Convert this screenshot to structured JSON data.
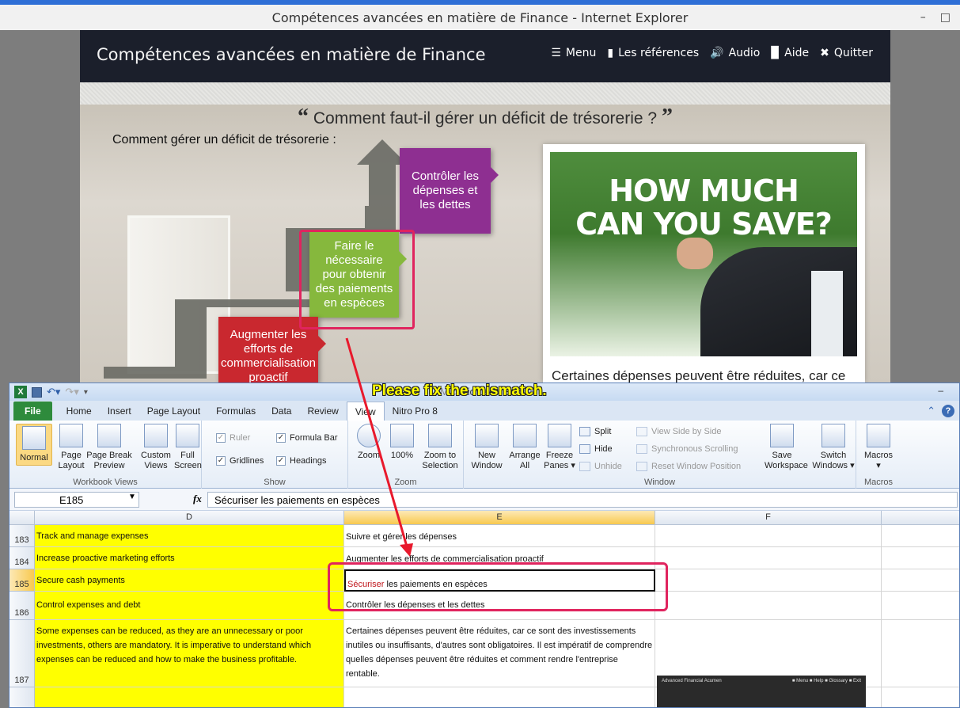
{
  "browser": {
    "window_title": "Compétences avancées en matière de Finance - Internet Explorer",
    "controls": [
      "–",
      "□"
    ]
  },
  "course": {
    "title": "Compétences avancées en matière de Finance",
    "nav": [
      {
        "label": "Menu",
        "icon": "menu-icon",
        "glyph": "☰"
      },
      {
        "label": "Les références",
        "icon": "bookmark-icon",
        "glyph": "▮"
      },
      {
        "label": "Audio",
        "icon": "speaker-icon",
        "glyph": "🔊"
      },
      {
        "label": "Aide",
        "icon": "book-icon",
        "glyph": "▉"
      },
      {
        "label": "Quitter",
        "icon": "close-icon",
        "glyph": "✖"
      }
    ],
    "question": "Comment faut-il gérer un déficit de trésorerie ?",
    "quote_open": "“",
    "quote_close": "”",
    "intro": "Comment gérer un déficit de trésorerie :",
    "steps": {
      "control": "Contrôler les dépenses et les dettes",
      "cash": "Faire le nécessaire pour obtenir des paiements en espèces",
      "marketing": "Augmenter les efforts de commercialisation proactif"
    },
    "card": {
      "image_text_line1": "HOW MUCH",
      "image_text_line2": "CAN YOU SAVE?",
      "text": "Certaines dépenses peuvent être réduites, car ce"
    },
    "colors": {
      "header": "#1b1f2b",
      "purple": "#8e2f91",
      "green": "#86b83d",
      "red": "#c9282f"
    }
  },
  "excel": {
    "title_prefix": "Mic",
    "title": "Microsoft Excel",
    "tabs": [
      "Home",
      "Insert",
      "Page Layout",
      "Formulas",
      "Data",
      "Review",
      "View",
      "Nitro Pro 8"
    ],
    "file_tab": "File",
    "active_tab": "View",
    "ribbon": {
      "workbook_views": {
        "label": "Workbook Views",
        "normal": "Normal",
        "page_layout_1": "Page",
        "page_layout_2": "Layout",
        "page_break_1": "Page Break",
        "page_break_2": "Preview",
        "custom_1": "Custom",
        "custom_2": "Views",
        "full_1": "Full",
        "full_2": "Screen"
      },
      "show": {
        "label": "Show",
        "ruler": "Ruler",
        "formula_bar": "Formula Bar",
        "gridlines": "Gridlines",
        "headings": "Headings"
      },
      "zoom": {
        "label": "Zoom",
        "zoom": "Zoom",
        "hundred": "100%",
        "selection_1": "Zoom to",
        "selection_2": "Selection"
      },
      "window": {
        "label": "Window",
        "new_1": "New",
        "new_2": "Window",
        "arrange_1": "Arrange",
        "arrange_2": "All",
        "freeze_1": "Freeze",
        "freeze_2": "Panes ▾",
        "split": "Split",
        "hide": "Hide",
        "unhide": "Unhide",
        "side_by_side": "View Side by Side",
        "sync_scroll": "Synchronous Scrolling",
        "reset_pos": "Reset Window Position",
        "save_1": "Save",
        "save_2": "Workspace",
        "switch_1": "Switch",
        "switch_2": "Windows ▾"
      },
      "macros": {
        "label": "Macros",
        "button": "Macros",
        "arrow": "▾"
      }
    },
    "formula_bar": {
      "name_box": "E185",
      "fx": "fx",
      "value": "Sécuriser les paiements en espèces"
    },
    "columns": [
      "D",
      "E",
      "F"
    ],
    "rows": [
      {
        "num": "183",
        "d": "Track and manage expenses",
        "e": "Suivre et gérer les dépenses"
      },
      {
        "num": "184",
        "d": "Increase proactive marketing efforts",
        "e": "Augmenter les efforts de commercialisation proactif"
      },
      {
        "num": "185",
        "d": "Secure cash payments",
        "e_red": "Sécuriser",
        "e_rest": " les paiements en espèces"
      },
      {
        "num": "186",
        "d": "Control expenses and debt",
        "e": "Contrôler les dépenses et les dettes"
      },
      {
        "num": "187",
        "d": "Some expenses can be reduced, as they are an unnecessary or poor investments, others are mandatory. It is imperative to understand which expenses can be reduced and how to make the business profitable.",
        "e": "Certaines dépenses peuvent être réduites, car ce sont des investissements inutiles ou insuffisants, d'autres sont obligatoires. Il est impératif de comprendre quelles dépenses peuvent être réduites et comment rendre l'entreprise rentable."
      }
    ],
    "thumbnail_title": "Advanced Financial Acumen",
    "thumbnail_nav": "■ Menu  ■ Help  ■ Glossary  ■ Exit"
  },
  "annotation": {
    "text": "Please fix the mismatch.",
    "color": "#e0245e"
  }
}
